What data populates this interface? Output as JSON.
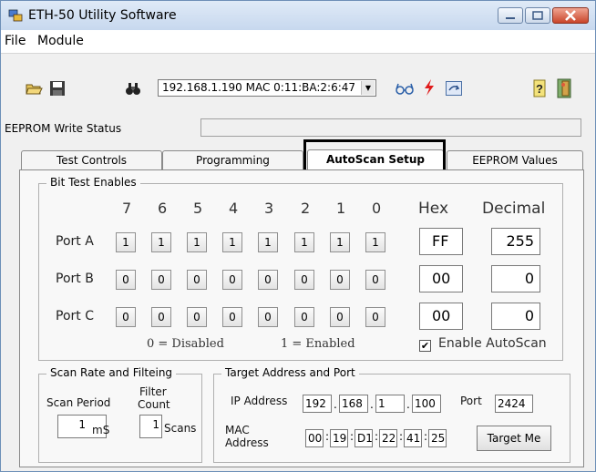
{
  "window": {
    "title": "ETH-50   Utility Software"
  },
  "menu": {
    "file": "File",
    "module": "Module"
  },
  "toolbar": {
    "device_select": "192.168.1.190   MAC 0:11:BA:2:6:47"
  },
  "status": {
    "eeprom_label": "EEPROM Write Status",
    "eeprom_value": ""
  },
  "tabs": [
    {
      "label": "Test Controls"
    },
    {
      "label": "Programming"
    },
    {
      "label": "AutoScan Setup"
    },
    {
      "label": "EEPROM Values"
    }
  ],
  "bit_test": {
    "title": "Bit Test Enables",
    "bit_headers": [
      "7",
      "6",
      "5",
      "4",
      "3",
      "2",
      "1",
      "0"
    ],
    "hex_header": "Hex",
    "decimal_header": "Decimal",
    "ports": [
      {
        "label": "Port A",
        "bits": [
          "1",
          "1",
          "1",
          "1",
          "1",
          "1",
          "1",
          "1"
        ],
        "hex": "FF",
        "decimal": "255"
      },
      {
        "label": "Port B",
        "bits": [
          "0",
          "0",
          "0",
          "0",
          "0",
          "0",
          "0",
          "0"
        ],
        "hex": "00",
        "decimal": "0"
      },
      {
        "label": "Port C",
        "bits": [
          "0",
          "0",
          "0",
          "0",
          "0",
          "0",
          "0",
          "0"
        ],
        "hex": "00",
        "decimal": "0"
      }
    ],
    "legend_disabled": "0 = Disabled",
    "legend_enabled": "1 = Enabled",
    "enable_autoscan_label": "Enable AutoScan",
    "enable_autoscan_checked": "✔"
  },
  "scan_rate": {
    "title": "Scan Rate and Filteing",
    "period_label": "Scan Period",
    "filter_label_1": "Filter",
    "filter_label_2": "Count",
    "period_value": "1",
    "period_unit": "mS",
    "filter_value": "1",
    "filter_unit": "Scans"
  },
  "target": {
    "title": "Target Address and Port",
    "ip_label": "IP Address",
    "ip": [
      "192",
      "168",
      "1",
      "100"
    ],
    "port_label": "Port",
    "port": "2424",
    "mac_label_1": "MAC",
    "mac_label_2": "Address",
    "mac": [
      "00",
      "19",
      "D1",
      "22",
      "41",
      "25"
    ],
    "target_me": "Target Me"
  }
}
